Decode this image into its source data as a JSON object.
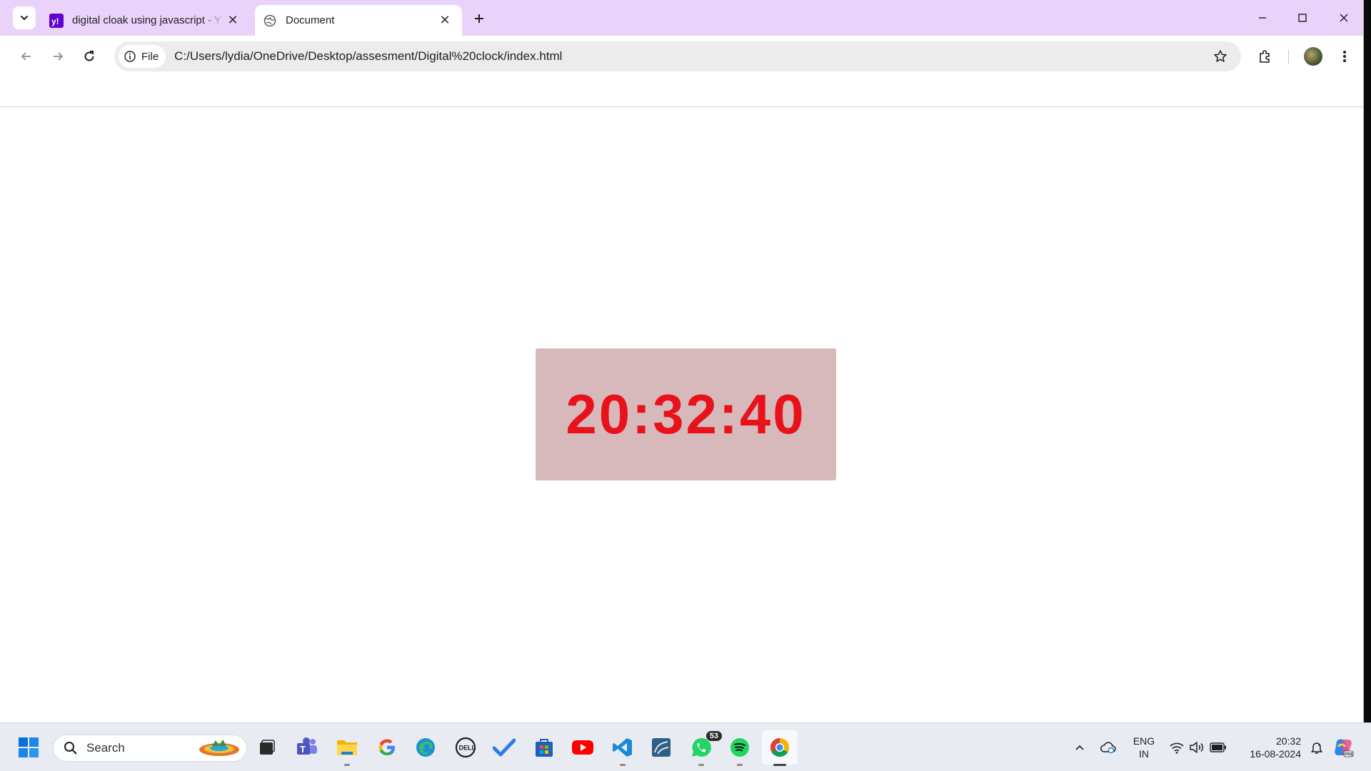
{
  "browser": {
    "tabs": [
      {
        "title": "digital cloak using javascript - Y",
        "active": false
      },
      {
        "title": "Document",
        "active": true
      }
    ],
    "omnibox": {
      "chip_label": "File",
      "url": "C:/Users/lydia/OneDrive/Desktop/assesment/Digital%20clock/index.html"
    }
  },
  "page": {
    "clock_time": "20:32:40",
    "clock_color": "#e8121b",
    "clock_background": "#d7b9bb"
  },
  "taskbar": {
    "search_label": "Search",
    "whatsapp_badge": "53",
    "language_line1": "ENG",
    "language_line2": "IN",
    "time": "20:32",
    "date": "16-08-2024"
  }
}
